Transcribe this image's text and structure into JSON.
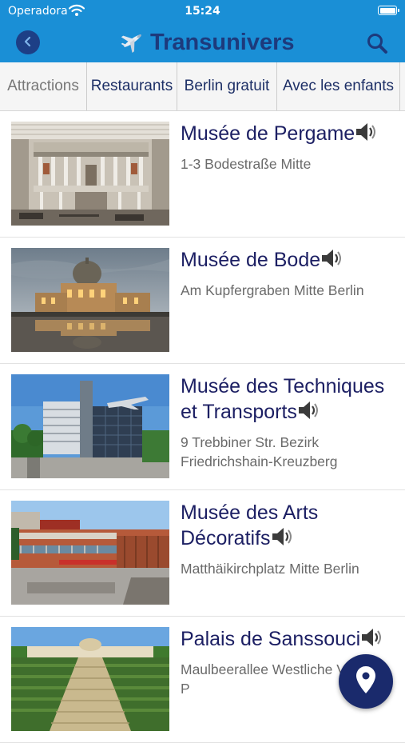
{
  "status_bar": {
    "carrier": "Operadora",
    "time": "15:24",
    "wifi_icon": "wifi-icon",
    "battery_icon": "battery-icon"
  },
  "header": {
    "title": "Transunivers",
    "background_color": "#1a8fd6",
    "title_color": "#1d3a7c",
    "logo_icon": "airplane-icon",
    "back_icon": "chevron-left-icon",
    "search_icon": "search-icon"
  },
  "tabs": [
    {
      "label": "Attractions",
      "active": true
    },
    {
      "label": "Restaurants",
      "active": false
    },
    {
      "label": "Berlin gratuit",
      "active": false
    },
    {
      "label": "Avec les enfants",
      "active": false
    }
  ],
  "items": [
    {
      "title": "Musée de Pergame",
      "address": "1-3 Bodestraße Mitte",
      "audio_icon": "speaker-icon"
    },
    {
      "title": "Musée de Bode",
      "address": "Am Kupfergraben Mitte Berlin",
      "audio_icon": "speaker-icon"
    },
    {
      "title": "Musée des Techniques et Transports",
      "address": "9 Trebbiner Str. Bezirk Friedrichshain-Kreuzberg",
      "audio_icon": "speaker-icon"
    },
    {
      "title": "Musée des Arts Décoratifs",
      "address": "Matthäikirchplatz Mitte Berlin",
      "audio_icon": "speaker-icon"
    },
    {
      "title": "Palais de Sanssouci",
      "address": "Maulbeerallee Westliche Vorstadt P",
      "audio_icon": "speaker-icon"
    }
  ],
  "map_button": {
    "icon": "map-pin-icon",
    "color": "#1a2a6c"
  }
}
